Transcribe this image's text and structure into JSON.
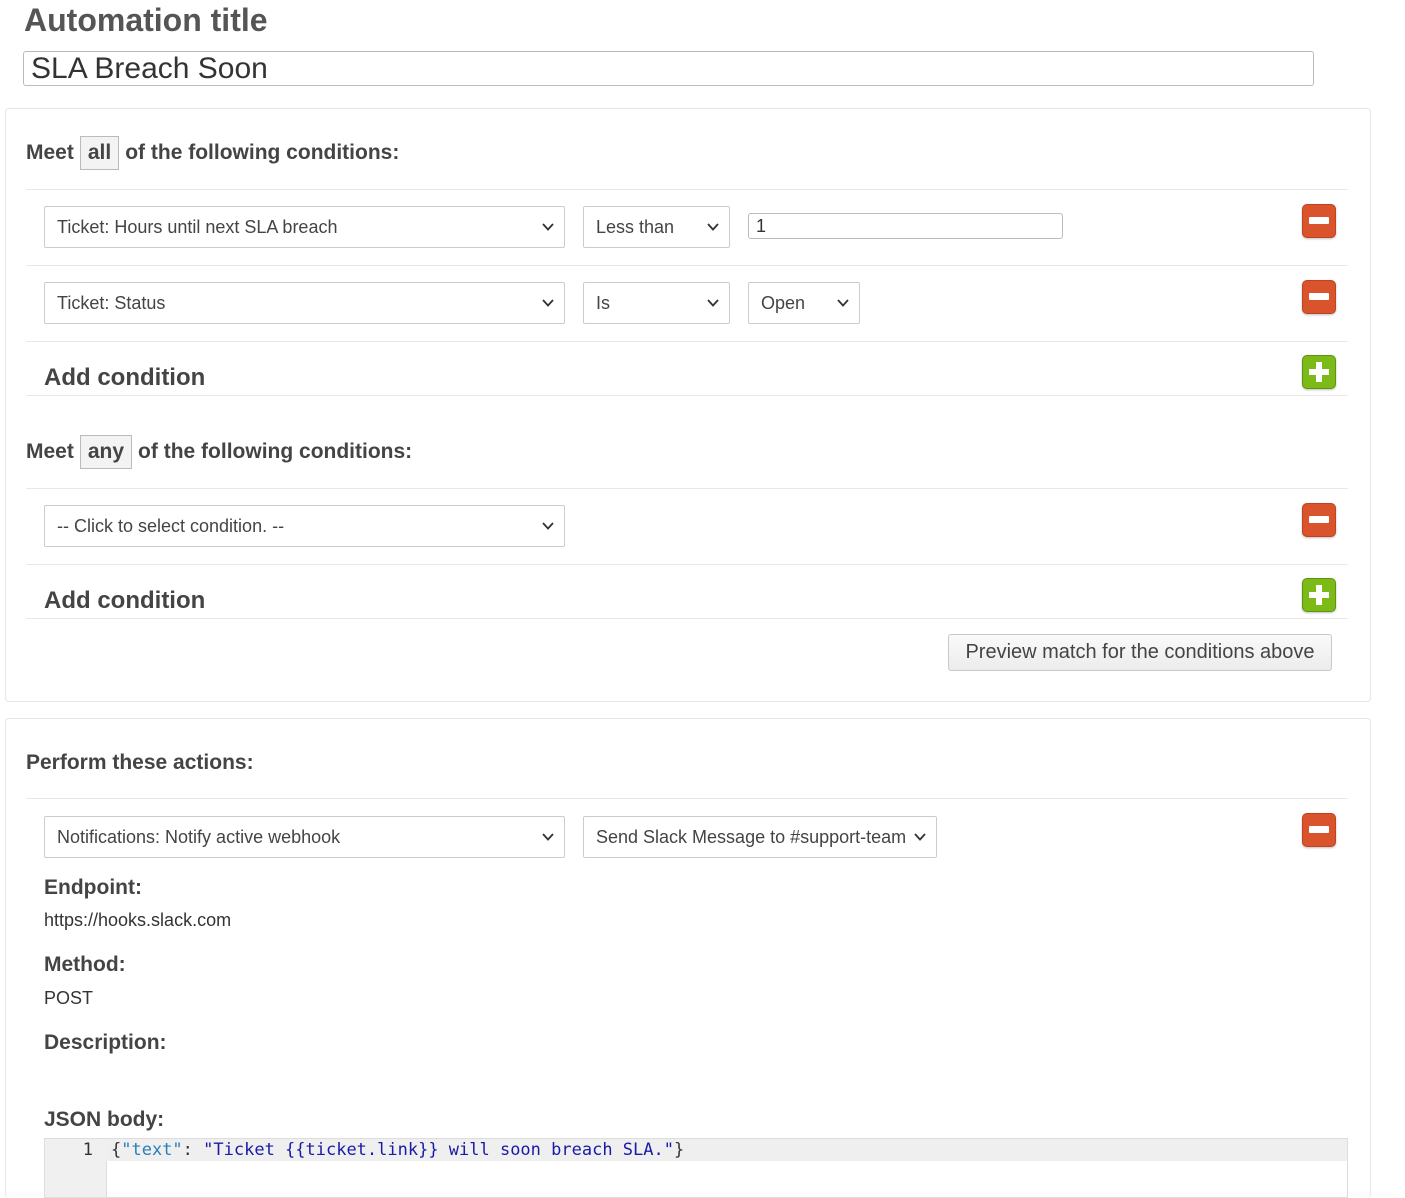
{
  "header": {
    "title_label": "Automation title",
    "title_value": "SLA Breach Soon"
  },
  "conditions_all": {
    "meet": "Meet",
    "mode": "all",
    "suffix": "of the following conditions:",
    "rows": [
      {
        "field": "Ticket: Hours until next SLA breach",
        "operator": "Less than",
        "value": "1"
      },
      {
        "field": "Ticket: Status",
        "operator": "Is",
        "value": "Open"
      }
    ],
    "add_label": "Add condition"
  },
  "conditions_any": {
    "meet": "Meet",
    "mode": "any",
    "suffix": "of the following conditions:",
    "rows": [
      {
        "field": "-- Click to select condition. --"
      }
    ],
    "add_label": "Add condition"
  },
  "preview_label": "Preview match for the conditions above",
  "actions": {
    "heading": "Perform these actions:",
    "action": "Notifications: Notify active webhook",
    "target": "Send Slack Message to #support-team",
    "endpoint_label": "Endpoint:",
    "endpoint_value": "https://hooks.slack.com",
    "method_label": "Method:",
    "method_value": "POST",
    "description_label": "Description:",
    "json_label": "JSON body:",
    "code_line_number": "1",
    "code_open": "{",
    "code_key": "\"text\"",
    "code_colon": ": ",
    "code_string": "\"Ticket {{ticket.link}} will soon breach SLA.\"",
    "code_close": "}"
  },
  "colors": {
    "remove": "#d9542c",
    "add": "#7cba18"
  },
  "icons": {
    "remove": "minus-icon",
    "add": "plus-icon",
    "dropdown": "chevron-down-icon"
  }
}
